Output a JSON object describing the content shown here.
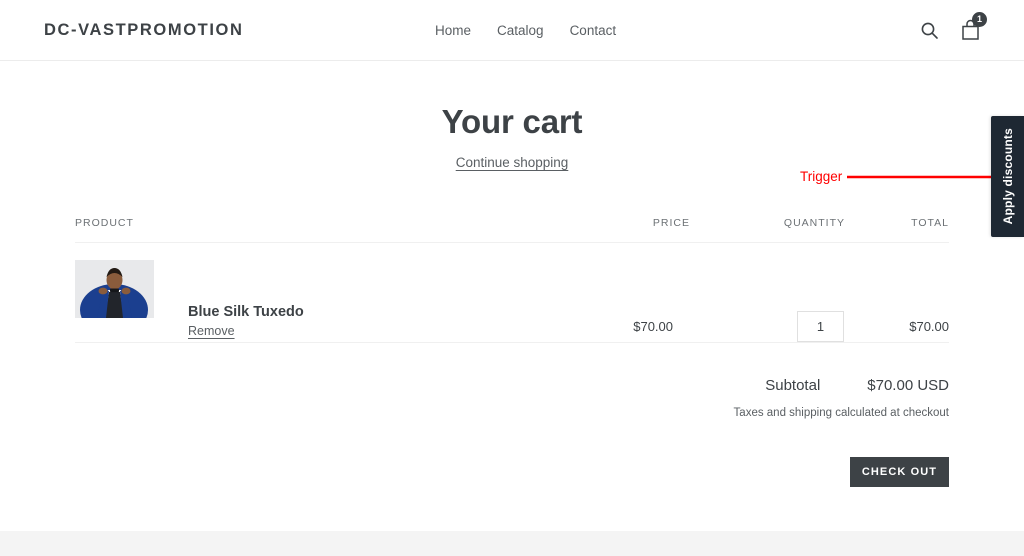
{
  "header": {
    "logo": "DC-VASTPROMOTION",
    "nav": [
      {
        "label": "Home"
      },
      {
        "label": "Catalog"
      },
      {
        "label": "Contact"
      }
    ],
    "search_icon": "search-icon",
    "cart_icon": "shopping-bag-icon",
    "cart_count": "1"
  },
  "cart": {
    "title": "Your cart",
    "continue_shopping": "Continue shopping",
    "columns": {
      "product": "PRODUCT",
      "price": "PRICE",
      "quantity": "QUANTITY",
      "total": "TOTAL"
    },
    "items": [
      {
        "name": "Blue Silk Tuxedo",
        "remove_label": "Remove",
        "price": "$70.00",
        "quantity": "1",
        "total": "$70.00",
        "image_alt": "man-in-blue-tuxedo-photo"
      }
    ],
    "subtotal_label": "Subtotal",
    "subtotal_value": "$70.00 USD",
    "tax_note": "Taxes and shipping calculated at checkout",
    "checkout_label": "CHECK OUT"
  },
  "discount_tab": {
    "label": "Apply discounts",
    "color": "#1e2833"
  },
  "annotation": {
    "label": "Trigger",
    "color": "#ff0000"
  }
}
